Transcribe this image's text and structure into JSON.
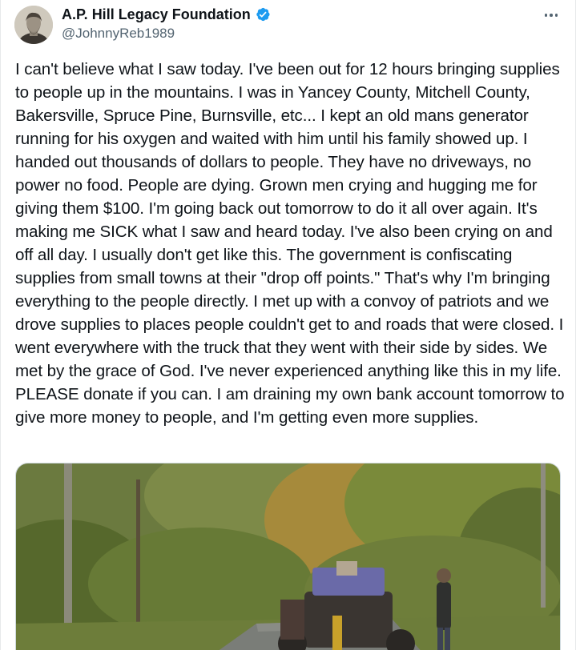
{
  "author": {
    "display_name": "A.P. Hill Legacy Foundation",
    "handle": "@JohnnyReb1989",
    "verified": true,
    "verified_color": "#1d9bf0"
  },
  "post": {
    "text": "I can't believe what I saw today. I've been out for 12 hours bringing supplies to people up in the mountains. I was in Yancey County, Mitchell County, Bakersville, Spruce Pine, Burnsville, etc... I kept an old mans generator running for his oxygen and waited with him until his family showed up. I handed out thousands of dollars to people. They have no driveways, no power no food. People are dying. Grown men crying and hugging me for giving them $100. I'm going back out tomorrow to do it all over again. It's making me SICK what I saw and heard today. I've also been crying on and off all day. I usually don't get like this. The government is confiscating supplies from small towns at their \"drop off points.\" That's why I'm bringing everything to the people directly. I met up with a convoy of patriots and we drove supplies to places people couldn't get to and roads that were closed. I went everywhere with the truck that they went with their side by sides. We met by the grace of God. I've never experienced anything like this in my life. PLEASE donate if you can. I am draining my own bank account tomorrow to give more money to people, and I'm getting even more supplies."
  },
  "icons": {
    "more": "more-horizontal-icon",
    "verified": "verified-badge-icon"
  },
  "colors": {
    "text_primary": "#0f1419",
    "text_secondary": "#536471",
    "border": "#cfd9de"
  }
}
